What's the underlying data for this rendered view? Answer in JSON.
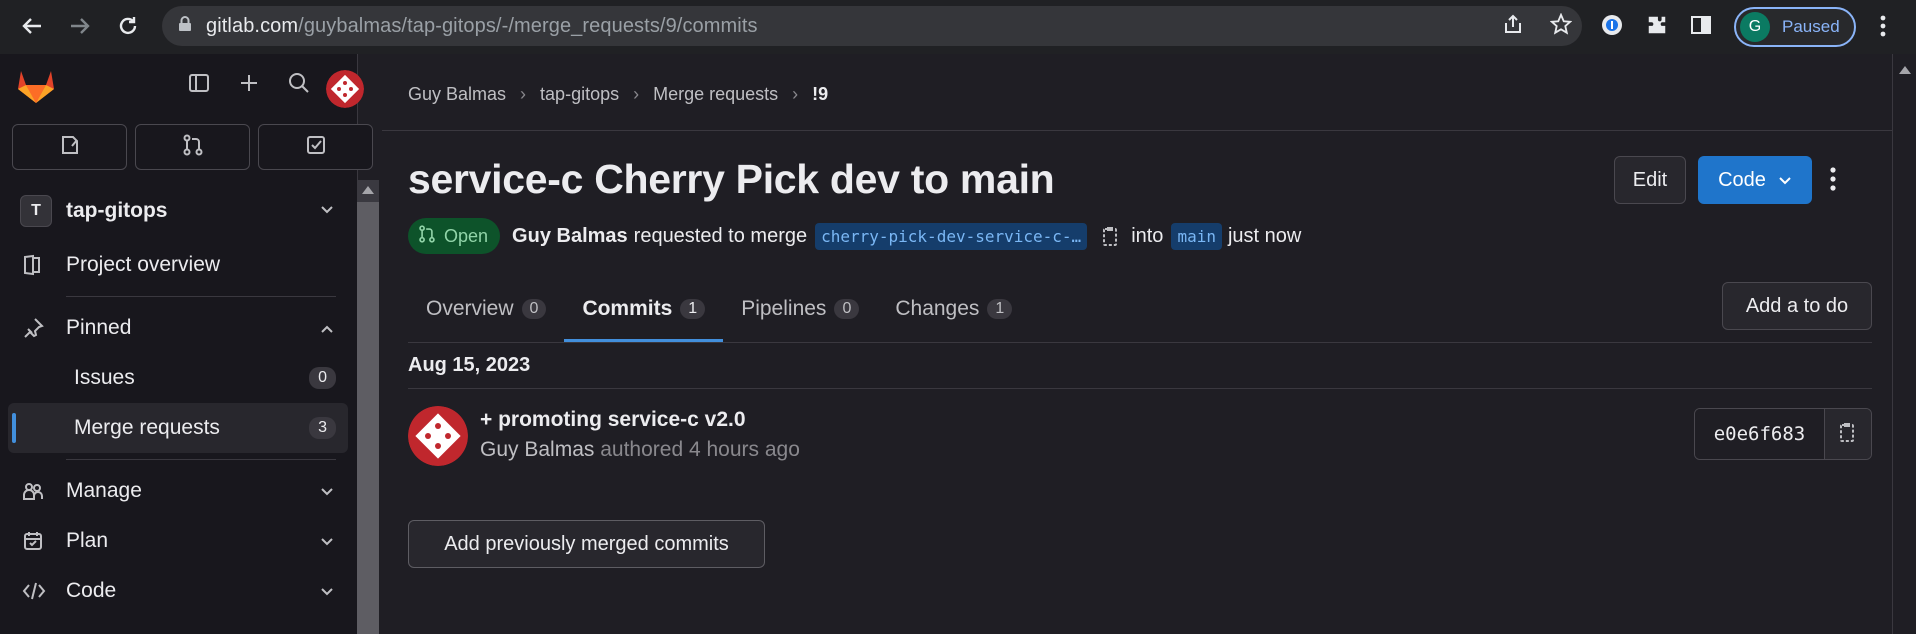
{
  "browser": {
    "url_host": "gitlab.com",
    "url_path": "/guybalmas/tap-gitops/-/merge_requests/9/commits",
    "profile_initial": "G",
    "profile_label": "Paused"
  },
  "sidebar": {
    "project_initial": "T",
    "project_name": "tap-gitops",
    "items": [
      {
        "label": "Project overview"
      },
      {
        "label": "Pinned"
      },
      {
        "label": "Manage"
      },
      {
        "label": "Plan"
      },
      {
        "label": "Code"
      }
    ],
    "pinned": [
      {
        "label": "Issues",
        "count": "0"
      },
      {
        "label": "Merge requests",
        "count": "3"
      }
    ]
  },
  "breadcrumb": [
    "Guy Balmas",
    "tap-gitops",
    "Merge requests",
    "!9"
  ],
  "mr": {
    "title": "service-c Cherry Pick dev to main",
    "status": "Open",
    "author": "Guy Balmas",
    "requested_text": "requested to merge",
    "source_branch": "cherry-pick-dev-service-c-…",
    "into_text": "into",
    "target_branch": "main",
    "time": "just now",
    "edit_label": "Edit",
    "code_label": "Code"
  },
  "tabs": [
    {
      "label": "Overview",
      "count": "0"
    },
    {
      "label": "Commits",
      "count": "1"
    },
    {
      "label": "Pipelines",
      "count": "0"
    },
    {
      "label": "Changes",
      "count": "1"
    }
  ],
  "todo_label": "Add a to do",
  "commits": {
    "date": "Aug 15, 2023",
    "items": [
      {
        "message": "+ promoting service-c v2.0",
        "author": "Guy Balmas",
        "authored": "authored 4 hours ago",
        "sha": "e0e6f683"
      }
    ]
  },
  "add_prev_label": "Add previously merged commits",
  "colors": {
    "accent": "#1f75cb",
    "open_badge": "#0d532a",
    "branch_bg": "#153d6b"
  }
}
